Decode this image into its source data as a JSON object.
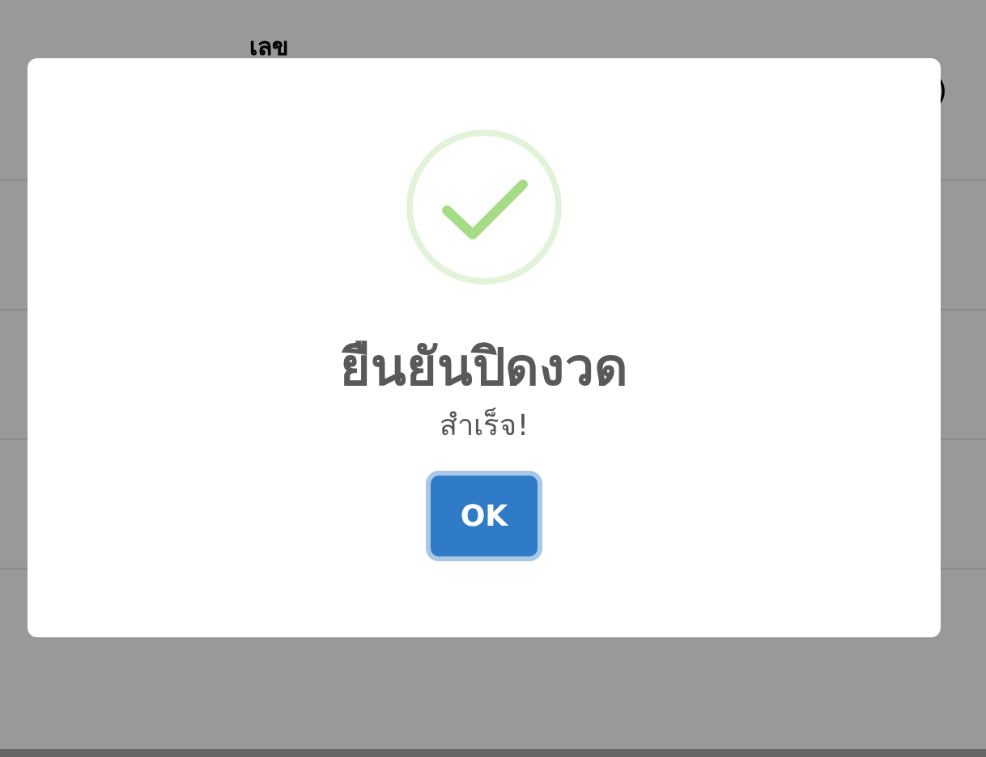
{
  "page": {
    "column_heading": "เลข",
    "cut_text": ")"
  },
  "dialog": {
    "title": "ยืนยันปิดงวด",
    "message": "สำเร็จ!",
    "buttons": [
      {
        "label": "OK",
        "selected": true
      }
    ]
  }
}
